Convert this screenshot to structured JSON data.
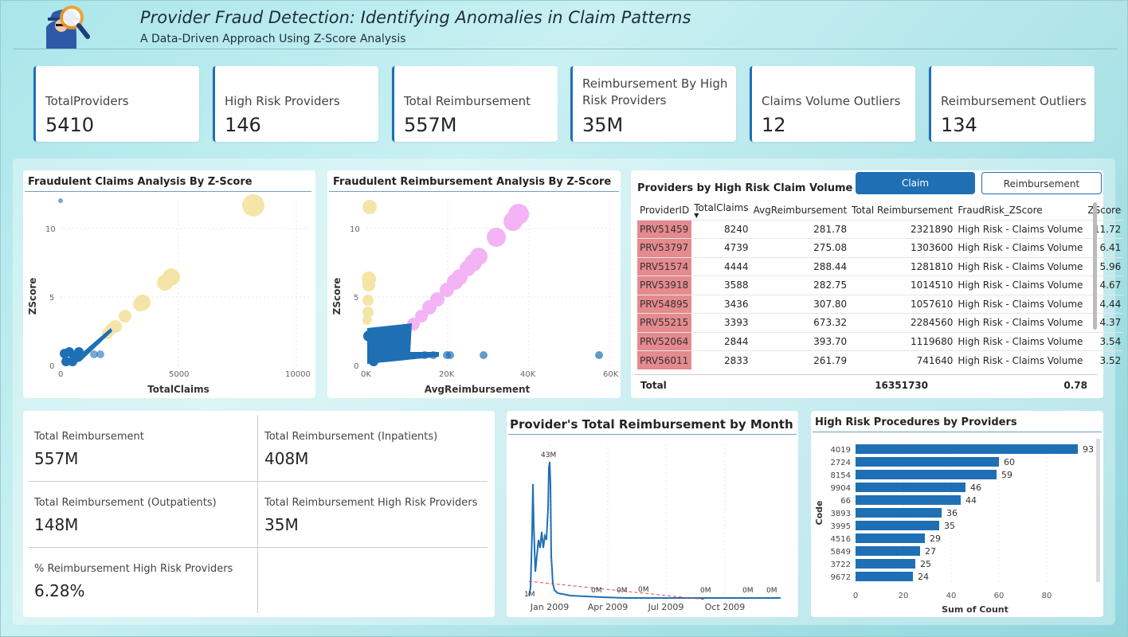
{
  "header": {
    "title": "Provider Fraud Detection: Identifying Anomalies in Claim Patterns",
    "subtitle": "A Data-Driven Approach Using Z-Score Analysis",
    "logo_icon": "detective-magnifier-icon"
  },
  "kpis": [
    {
      "label": "TotalProviders",
      "value": "5410"
    },
    {
      "label": "High Risk Providers",
      "value": "146"
    },
    {
      "label": "Total Reimbursement",
      "value": "557M"
    },
    {
      "label": "Reimbursement By High Risk Providers",
      "value": "35M"
    },
    {
      "label": "Claims Volume Outliers",
      "value": "12"
    },
    {
      "label": "Reimbursement Outliers",
      "value": "134"
    }
  ],
  "scatter_claims": {
    "title": "Fraudulent Claims Analysis By Z-Score",
    "xlabel": "TotalClaims",
    "ylabel": "ZScore",
    "xticks": [
      "0",
      "5000",
      "10000"
    ],
    "yticks": [
      "0",
      "5",
      "10"
    ]
  },
  "scatter_reimb": {
    "title": "Fraudulent Reimbursement Analysis By Z-Score",
    "xlabel": "AvgReimbursement",
    "ylabel": "ZScore",
    "xticks": [
      "0K",
      "20K",
      "40K",
      "60K"
    ],
    "yticks": [
      "0",
      "5",
      "10"
    ]
  },
  "providers_table": {
    "title": "Providers by High Risk Claim Volume",
    "buttons": {
      "claim": "Claim",
      "reimbursement": "Reimbursement"
    },
    "columns": [
      "ProviderID",
      "TotalClaims",
      "AvgReimbursement",
      "Total Reimbursement",
      "FraudRisk_ZScore",
      "ZScore"
    ],
    "rows": [
      [
        "PRV51459",
        "8240",
        "281.78",
        "2321890",
        "High Risk - Claims Volume",
        "11.72"
      ],
      [
        "PRV53797",
        "4739",
        "275.08",
        "1303600",
        "High Risk - Claims Volume",
        "6.41"
      ],
      [
        "PRV51574",
        "4444",
        "288.44",
        "1281810",
        "High Risk - Claims Volume",
        "5.96"
      ],
      [
        "PRV53918",
        "3588",
        "282.75",
        "1014510",
        "High Risk - Claims Volume",
        "4.67"
      ],
      [
        "PRV54895",
        "3436",
        "307.80",
        "1057610",
        "High Risk - Claims Volume",
        "4.44"
      ],
      [
        "PRV55215",
        "3393",
        "673.32",
        "2284560",
        "High Risk - Claims Volume",
        "4.37"
      ],
      [
        "PRV52064",
        "2844",
        "393.70",
        "1119680",
        "High Risk - Claims Volume",
        "3.54"
      ],
      [
        "PRV56011",
        "2833",
        "261.79",
        "741640",
        "High Risk - Claims Volume",
        "3.52"
      ]
    ],
    "total": {
      "label": "Total",
      "total_reimbursement": "16351730",
      "zscore": "0.78"
    }
  },
  "summary": {
    "total_reimbursement": {
      "label": "Total Reimbursement",
      "value": "557M"
    },
    "inpatients": {
      "label": "Total Reimbursement (Inpatients)",
      "value": "408M"
    },
    "outpatients": {
      "label": "Total Reimbursement (Outpatients)",
      "value": "148M"
    },
    "high_risk": {
      "label": "Total Reimbursement High Risk Providers",
      "value": "35M"
    },
    "pct_high_risk": {
      "label": "% Reimbursement High Risk Providers",
      "value": "6.28%"
    }
  },
  "monthly": {
    "title": "Provider's Total Reimbursement by Month",
    "xticks": [
      "Jan 2009",
      "Apr 2009",
      "Jul 2009",
      "Oct 2009"
    ],
    "data_labels": [
      "43M",
      "1M",
      "0M",
      "0M",
      "0M",
      "0M",
      "0M",
      "0M"
    ]
  },
  "chart_data": {
    "type": "bar",
    "title": "High Risk Procedures by Providers",
    "xlabel": "Sum of Count",
    "ylabel": "Code",
    "categories": [
      "4019",
      "2724",
      "8154",
      "9904",
      "66",
      "3893",
      "3995",
      "4516",
      "5849",
      "3722",
      "9672"
    ],
    "values": [
      93,
      60,
      59,
      46,
      44,
      36,
      35,
      29,
      27,
      25,
      24
    ],
    "xticks": [
      "0",
      "20",
      "40",
      "60",
      "80"
    ],
    "xlim": [
      0,
      100
    ],
    "color": "#1f6fb5"
  }
}
